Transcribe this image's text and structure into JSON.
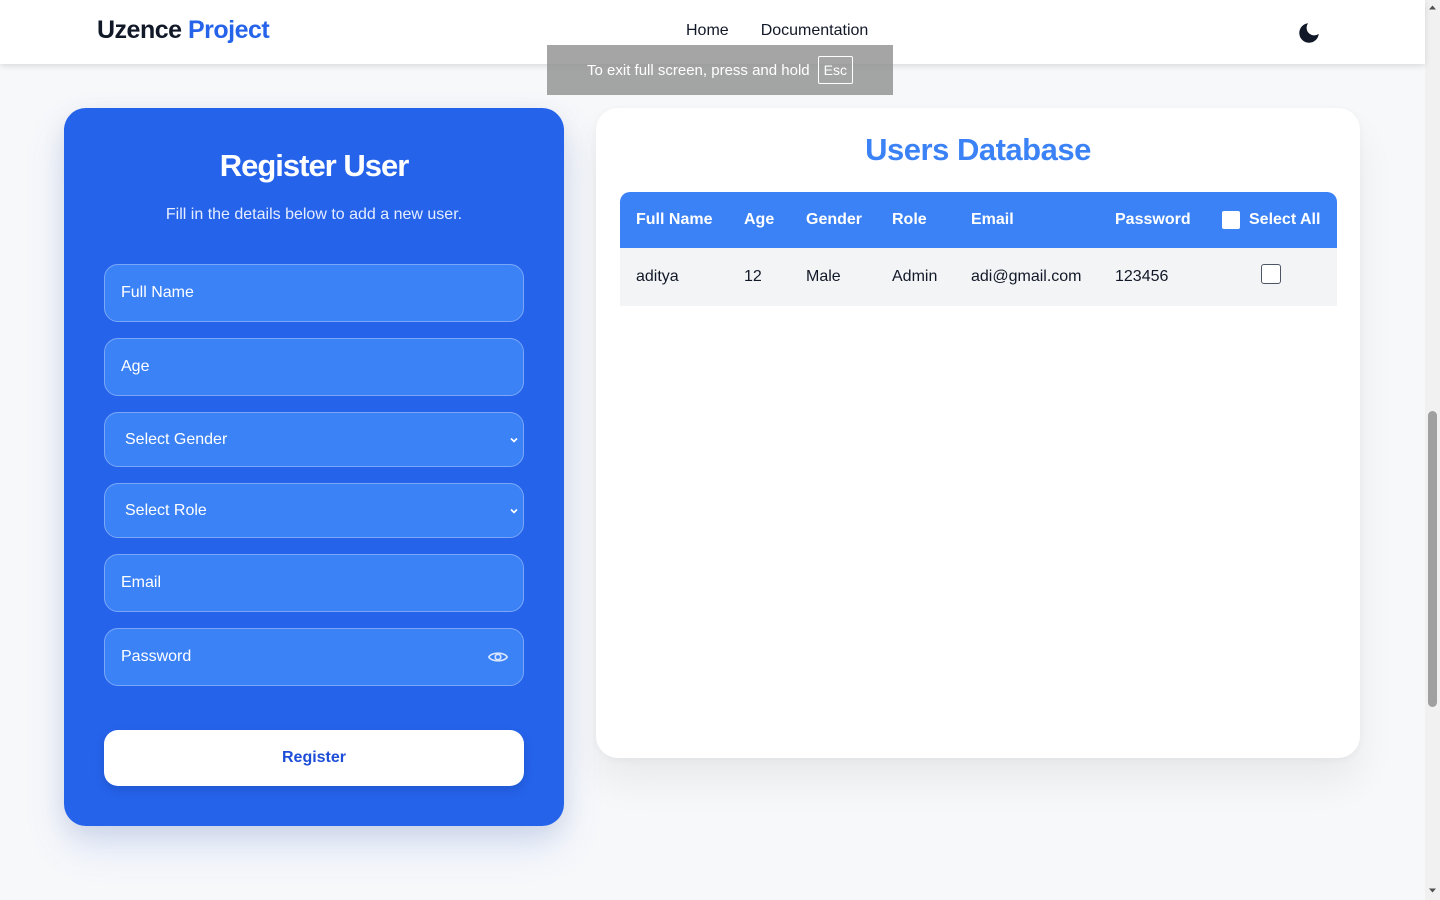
{
  "brand": {
    "name": "Uzence",
    "accent": "Project"
  },
  "nav": {
    "items": [
      "Home",
      "Documentation"
    ]
  },
  "theme_toggle": {
    "icon": "moon-icon"
  },
  "fullscreen_toast": {
    "text": "To exit full screen, press and hold",
    "key": "Esc"
  },
  "register": {
    "title": "Register User",
    "subtitle": "Fill in the details below to add a new user.",
    "fields": {
      "full_name": {
        "placeholder": "Full Name",
        "value": ""
      },
      "age": {
        "placeholder": "Age",
        "value": ""
      },
      "gender": {
        "selected": "Select Gender"
      },
      "role": {
        "selected": "Select Role"
      },
      "email": {
        "placeholder": "Email",
        "value": ""
      },
      "password": {
        "placeholder": "Password",
        "value": ""
      }
    },
    "button": "Register"
  },
  "database": {
    "title": "Users Database",
    "columns": [
      "Full Name",
      "Age",
      "Gender",
      "Role",
      "Email",
      "Password"
    ],
    "select_all_label": "Select All",
    "rows": [
      {
        "full_name": "aditya",
        "age": "12",
        "gender": "Male",
        "role": "Admin",
        "email": "adi@gmail.com",
        "password": "123456",
        "selected": false
      }
    ]
  },
  "colors": {
    "primary": "#2563eb",
    "field": "#3b82f6",
    "table_header": "#3b82f6",
    "background": "#f7f8fa"
  }
}
